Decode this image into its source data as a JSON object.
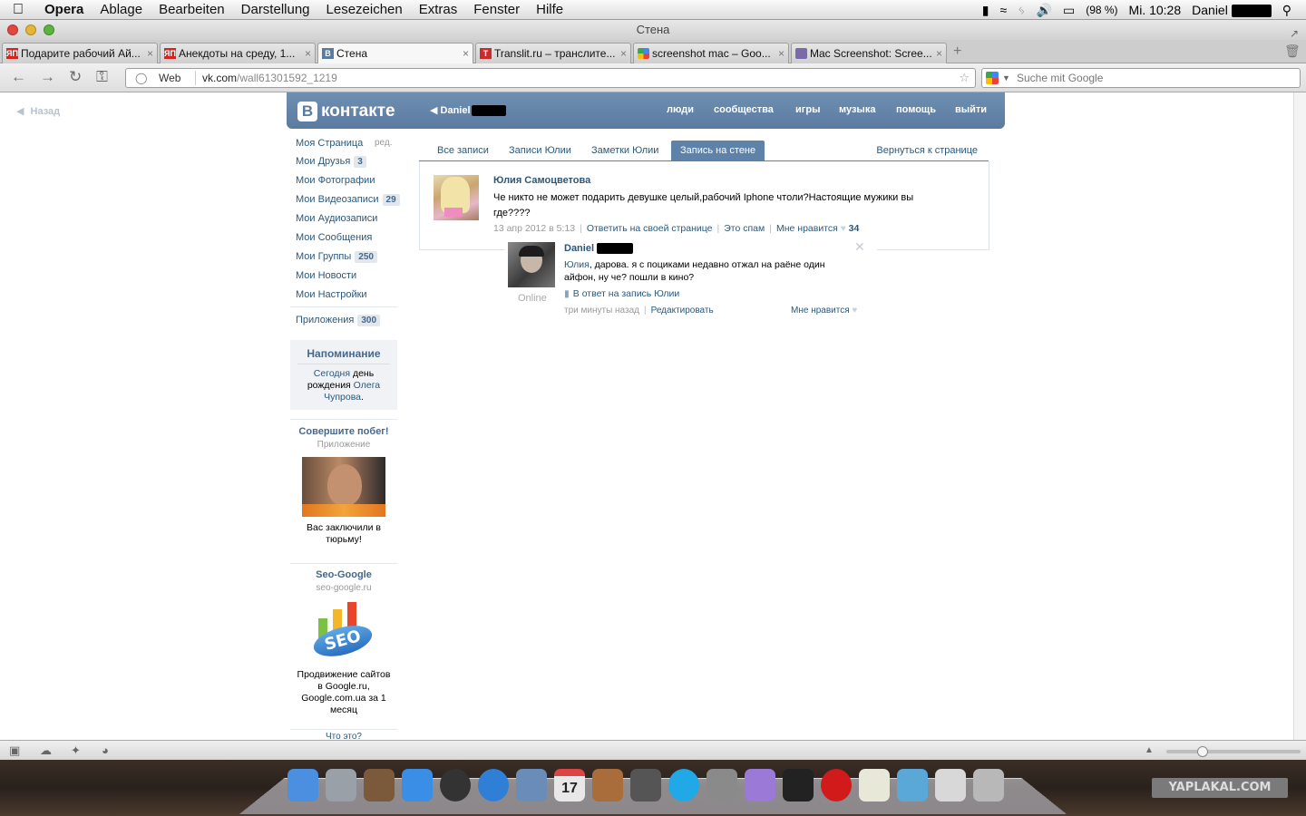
{
  "menubar": {
    "app": "Opera",
    "items": [
      "Ablage",
      "Bearbeiten",
      "Darstellung",
      "Lesezeichen",
      "Extras",
      "Fenster",
      "Hilfe"
    ],
    "battery": "(98 %)",
    "clock": "Mi. 10:28",
    "user": "Daniel"
  },
  "window": {
    "title": "Стена"
  },
  "tabs": [
    {
      "label": "Подарите рабочий Ай...",
      "fav": "ЯП",
      "fav_color": "#d8241f"
    },
    {
      "label": "Анекдоты на среду, 1...",
      "fav": "ЯП",
      "fav_color": "#d8241f"
    },
    {
      "label": "Стена",
      "fav": "В",
      "fav_color": "#5a7ba0"
    },
    {
      "label": "Translit.ru – транслите...",
      "fav": "T",
      "fav_color": "#cc2b2b"
    },
    {
      "label": "screenshot mac – Goo...",
      "fav": "",
      "fav_color": "#4285f4"
    },
    {
      "label": "Mac Screenshot: Scree...",
      "fav": "",
      "fav_color": "#7a6aa8"
    }
  ],
  "address": {
    "scheme_label": "Web",
    "host": "vk.com",
    "path": "/wall61301592_1219",
    "search_placeholder": "Suche mit Google"
  },
  "page": {
    "back": "Назад",
    "vk": {
      "logo": "контакте",
      "logo_letter": "В",
      "user": "Daniel",
      "nav": [
        "люди",
        "сообщества",
        "игры",
        "музыка",
        "помощь",
        "выйти"
      ]
    },
    "left_menu": {
      "edit": "ред.",
      "items": [
        {
          "label": "Моя Страница",
          "count": ""
        },
        {
          "label": "Мои Друзья",
          "count": "3"
        },
        {
          "label": "Мои Фотографии",
          "count": ""
        },
        {
          "label": "Мои Видеозаписи",
          "count": "29"
        },
        {
          "label": "Мои Аудиозаписи",
          "count": ""
        },
        {
          "label": "Мои Сообщения",
          "count": ""
        },
        {
          "label": "Мои Группы",
          "count": "250"
        },
        {
          "label": "Мои Новости",
          "count": ""
        },
        {
          "label": "Мои Настройки",
          "count": ""
        }
      ],
      "apps": {
        "label": "Приложения",
        "count": "300"
      }
    },
    "reminder": {
      "title": "Напоминание",
      "today": "Сегодня",
      "mid": " день рождения ",
      "name": "Олега Чупрова",
      "end": "."
    },
    "ads": [
      {
        "title": "Совершите побег!",
        "sub": "Приложение",
        "desc": "Вас заключили в тюрьму!"
      },
      {
        "title": "Seo-Google",
        "sub": "seo-google.ru",
        "desc": "Продвижение сайтов в Google.ru, Google.com.ua за 1 месяц",
        "logo": "SEO"
      }
    ],
    "what": "Что это?",
    "wall_tabs": [
      "Все записи",
      "Записи Юлии",
      "Заметки Юлии",
      "Запись на стене"
    ],
    "wall_back": "Вернуться к странице",
    "post": {
      "author": "Юлия Самоцветова",
      "text": "Че никто не может подарить девушке целый,рабочий Iphone чтоли?Настоящие мужики вы где????",
      "date": "13 апр 2012 в 5:13",
      "reply_link": "Ответить на своей странице",
      "spam": "Это спам",
      "like": "Мне нравится",
      "likes": "34"
    },
    "reply": {
      "author": "Daniel",
      "online": "Online",
      "addressee": "Юлия",
      "text": ", дарова. я с поциками недавно отжал на раёне один айфон, ну че? пошли в кино?",
      "in_reply": "В ответ на запись Юлии",
      "time": "три минуты назад",
      "edit": "Редактировать",
      "like": "Мне нравится"
    }
  },
  "dock": {
    "watermark": "YAPLAKAL.COM",
    "calendar_day": "17",
    "icons": [
      {
        "name": "finder-icon",
        "color": "#4a8fe0"
      },
      {
        "name": "launchpad-icon",
        "color": "#9aa0a8"
      },
      {
        "name": "photo-stack-icon",
        "color": "#7a5a3a"
      },
      {
        "name": "app-store-icon",
        "color": "#3a8ee6"
      },
      {
        "name": "dashboard-icon",
        "color": "#333333"
      },
      {
        "name": "itunes-icon",
        "color": "#2f7fd6"
      },
      {
        "name": "preview-icon",
        "color": "#6a8cb8"
      },
      {
        "name": "calendar-icon",
        "color": "#e8e8e8"
      },
      {
        "name": "iphoto-icon",
        "color": "#a86d3a"
      },
      {
        "name": "steam-icon",
        "color": "#555555"
      },
      {
        "name": "skype-icon",
        "color": "#21a8e6"
      },
      {
        "name": "system-preferences-icon",
        "color": "#8a8a8a"
      },
      {
        "name": "ichat-icon",
        "color": "#9a7ad6"
      },
      {
        "name": "terminal-icon",
        "color": "#222222"
      },
      {
        "name": "opera-icon",
        "color": "#d11a1a"
      },
      {
        "name": "textedit-icon",
        "color": "#e8e8d8"
      },
      {
        "name": "fish-icon",
        "color": "#5aa8d8"
      },
      {
        "name": "documents-icon",
        "color": "#d8d8d8"
      },
      {
        "name": "trash-icon",
        "color": "#b8b8b8"
      }
    ]
  }
}
